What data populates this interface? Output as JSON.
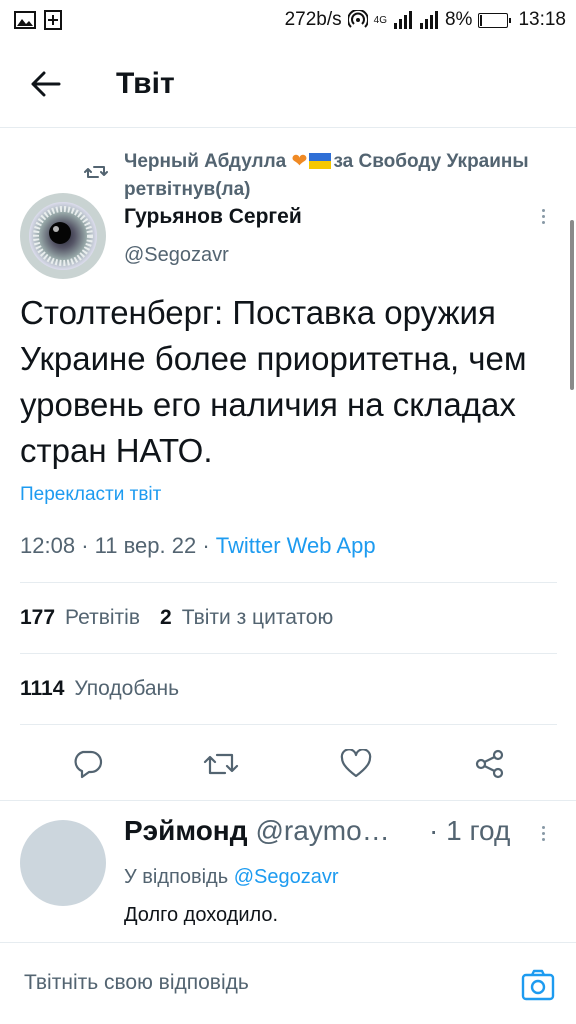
{
  "status_bar": {
    "net_speed": "272b/s",
    "network": "4G",
    "battery": "8%",
    "battery_level": 0.08,
    "time": "13:18"
  },
  "header": {
    "title": "Твіт",
    "back_icon": "arrow-left-icon"
  },
  "retweet": {
    "user": "Черный Абдулла",
    "after_emoji": "за Свободу Украины",
    "action": "ретвітнув(ла)",
    "icon": "retweet-icon"
  },
  "tweet": {
    "author_name": "Гурьянов Сергей",
    "author_handle": "@Segozavr",
    "text": "Столтенберг: Поставка оружия Украине более приоритетна, чем уровень его наличия на складах стран НАТО.",
    "translate": "Перекласти твіт",
    "time": "12:08",
    "date": "11 вер. 22",
    "source": "Twitter Web App",
    "retweets_count": "177",
    "retweets_label": "Ретвітів",
    "quotes_count": "2",
    "quotes_label": "Твіти з цитатою",
    "likes_count": "1114",
    "likes_label": "Уподобань"
  },
  "actions": [
    "reply-icon",
    "retweet-icon",
    "heart-icon",
    "share-icon"
  ],
  "reply": {
    "name": "Рэймонд",
    "handle": "@raymo…",
    "time": "· 1 год",
    "reply_to_label": "У відповідь",
    "reply_to_handle": "@Segozavr",
    "text": "Долго доходило."
  },
  "compose": {
    "placeholder": "Твітніть свою відповідь",
    "icon": "camera-icon"
  },
  "colors": {
    "accent": "#1d9bf0",
    "text_secondary": "#536471",
    "divider": "#e6ecf0"
  }
}
